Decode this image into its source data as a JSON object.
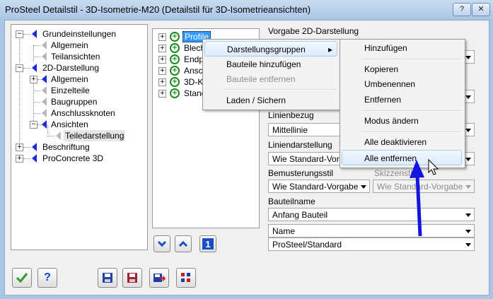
{
  "window": {
    "title": "ProSteel Detailstil - 3D-Isometrie-M20 (Detailstil für 3D-Isometrieansichten)"
  },
  "left_tree": [
    {
      "label": "Grundeinstellungen"
    },
    {
      "label": "Allgemein"
    },
    {
      "label": "Teilansichten"
    },
    {
      "label": "2D-Darstellung"
    },
    {
      "label": "Allgemein"
    },
    {
      "label": "Einzelteile"
    },
    {
      "label": "Baugruppen"
    },
    {
      "label": "Anschlussknoten"
    },
    {
      "label": "Ansichten"
    },
    {
      "label": "Teiledarstellung"
    },
    {
      "label": "Beschriftung"
    },
    {
      "label": "ProConcrete 3D"
    }
  ],
  "mid_tree": [
    "Profile",
    "Blech",
    "Endpl",
    "Ansch",
    "3D-Kö",
    "Stand"
  ],
  "right_panel": {
    "section_title": "Vorgabe 2D-Darstellung",
    "linienbezug_label": "Linienbezug",
    "linienbezug_value": "Mittellinie",
    "liniendarstellung_label": "Liniendarstellung",
    "liniendarstellung_value": "Wie Standard-Vorgabe",
    "bemusterungsstil_label": "Bemusterungsstil",
    "bemusterungsstil_value": "Wie Standard-Vorgabe",
    "skizzenstil_label": "Skizzenstil",
    "skizzenstil_value": "Wie Standard-Vorgabe",
    "bauteilname_label": "Bauteilname",
    "bauteilname_1": "Anfang Bauteil",
    "bauteilname_2": "Name",
    "bauteilname_3": "ProSteel/Standard"
  },
  "context_menu": {
    "item_1": "Darstellungsgruppen",
    "item_2": "Bauteile hinzufügen",
    "item_3": "Bauteile entfernen",
    "item_4": "Laden / Sichern"
  },
  "submenu": {
    "hinzufuegen": "Hinzufügen",
    "kopieren": "Kopieren",
    "umbenennen": "Umbenennen",
    "entfernen": "Entfernen",
    "modus": "Modus ändern",
    "deaktivieren": "Alle deaktivieren",
    "alle_entfernen": "Alle entfernen"
  },
  "colors": {
    "accent_blue": "#1a2fd6",
    "arrow_blue": "#1414e0",
    "ok_green": "#2a9a2a"
  }
}
